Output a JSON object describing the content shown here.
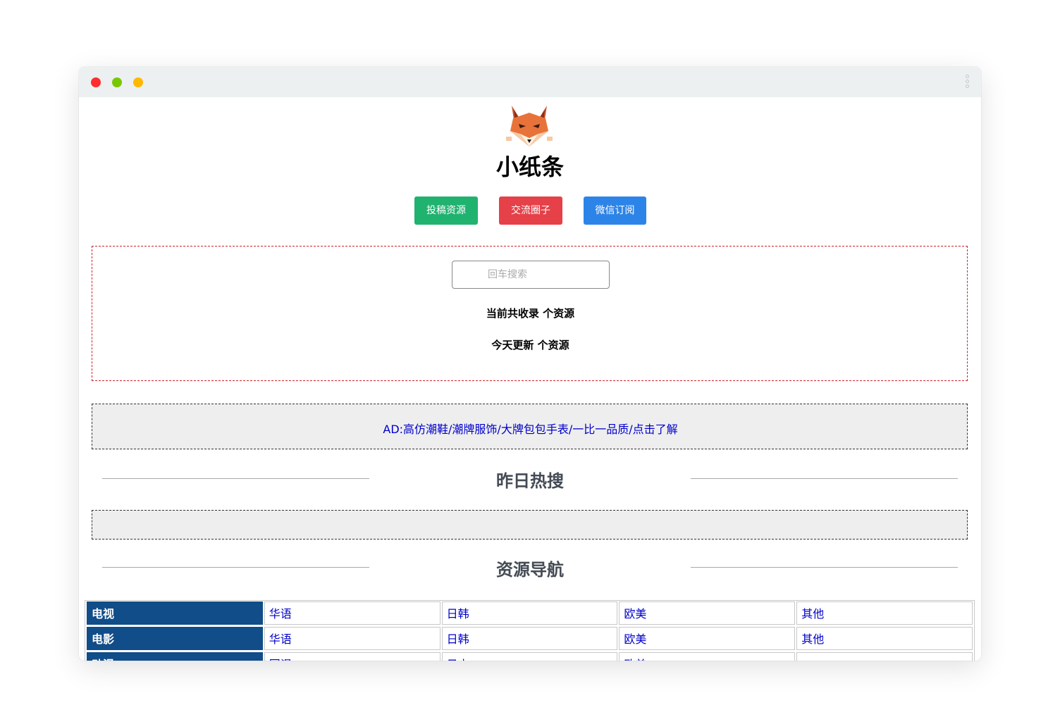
{
  "site": {
    "title": "小纸条",
    "logo_icon": "fox-logo-icon"
  },
  "buttons": {
    "submit": "投稿资源",
    "community": "交流圈子",
    "wechat": "微信订阅"
  },
  "colors": {
    "submit": "#20b26f",
    "community": "#e64048",
    "wechat": "#2d84e8",
    "nav_header": "#114d88",
    "link": "#0000cc"
  },
  "search": {
    "placeholder": "回车搜索",
    "total_text": "当前共收录 个资源",
    "today_text": "今天更新 个资源"
  },
  "ad": {
    "text": "AD:高仿潮鞋/潮牌服饰/大牌包包手表/一比一品质/点击了解"
  },
  "sections": {
    "hot": "昨日热搜",
    "nav": "资源导航"
  },
  "nav_table": {
    "rows": [
      {
        "header": "电视",
        "links": [
          "华语",
          "日韩",
          "欧美",
          "其他"
        ]
      },
      {
        "header": "电影",
        "links": [
          "华语",
          "日韩",
          "欧美",
          "其他"
        ]
      },
      {
        "header": "动漫",
        "links": [
          "国漫",
          "日本",
          "欧美",
          ""
        ]
      }
    ]
  }
}
